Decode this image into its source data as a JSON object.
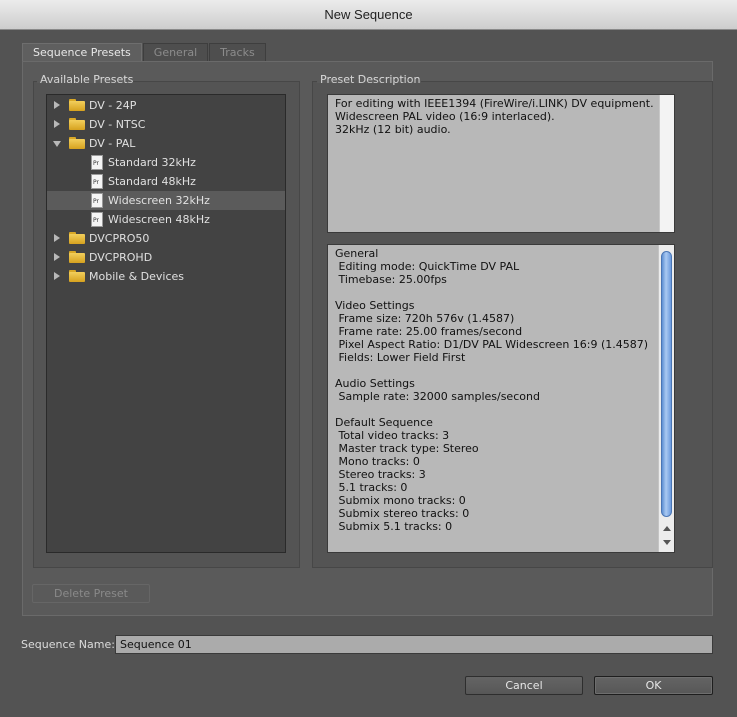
{
  "window": {
    "title": "New Sequence"
  },
  "tabs": [
    {
      "label": "Sequence Presets",
      "active": true
    },
    {
      "label": "General",
      "active": false
    },
    {
      "label": "Tracks",
      "active": false
    }
  ],
  "presets": {
    "title": "Available Presets",
    "items": [
      {
        "label": "DV - 24P",
        "type": "folder",
        "expanded": false,
        "selected": false
      },
      {
        "label": "DV - NTSC",
        "type": "folder",
        "expanded": false,
        "selected": false
      },
      {
        "label": "DV - PAL",
        "type": "folder",
        "expanded": true,
        "selected": false
      },
      {
        "label": "Standard 32kHz",
        "type": "file",
        "selected": false
      },
      {
        "label": "Standard 48kHz",
        "type": "file",
        "selected": false
      },
      {
        "label": "Widescreen 32kHz",
        "type": "file",
        "selected": true
      },
      {
        "label": "Widescreen 48kHz",
        "type": "file",
        "selected": false
      },
      {
        "label": "DVCPRO50",
        "type": "folder",
        "expanded": false,
        "selected": false
      },
      {
        "label": "DVCPROHD",
        "type": "folder",
        "expanded": false,
        "selected": false
      },
      {
        "label": "Mobile & Devices",
        "type": "folder",
        "expanded": false,
        "selected": false
      }
    ],
    "file_icon_text": "Pr",
    "delete_button": "Delete Preset"
  },
  "description": {
    "title": "Preset Description",
    "lines": [
      "For editing with IEEE1394 (FireWire/i.LINK) DV equipment.",
      "Widescreen PAL video (16:9 interlaced).",
      "32kHz (12 bit) audio."
    ]
  },
  "details": {
    "lines": [
      "General",
      " Editing mode: QuickTime DV PAL",
      " Timebase: 25.00fps",
      "",
      "Video Settings",
      " Frame size: 720h 576v (1.4587)",
      " Frame rate: 25.00 frames/second",
      " Pixel Aspect Ratio: D1/DV PAL Widescreen 16:9 (1.4587)",
      " Fields: Lower Field First",
      "",
      "Audio Settings",
      " Sample rate: 32000 samples/second",
      "",
      "Default Sequence",
      " Total video tracks: 3",
      " Master track type: Stereo",
      " Mono tracks: 0",
      " Stereo tracks: 3",
      " 5.1 tracks: 0",
      " Submix mono tracks: 0",
      " Submix stereo tracks: 0",
      " Submix 5.1 tracks: 0"
    ]
  },
  "sequence_name": {
    "label": "Sequence Name:",
    "value": "Sequence 01"
  },
  "buttons": {
    "cancel": "Cancel",
    "ok": "OK"
  }
}
